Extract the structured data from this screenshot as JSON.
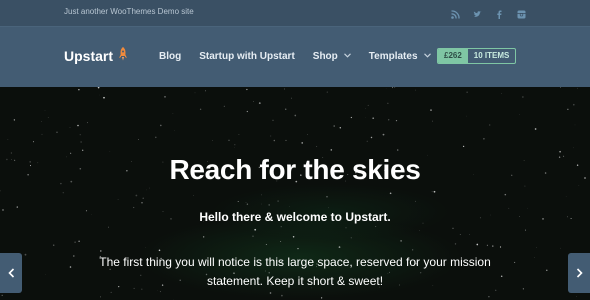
{
  "topbar": {
    "tagline": "Just another WooThemes Demo site",
    "social": [
      "rss-icon",
      "twitter-icon",
      "facebook-icon",
      "instagram-icon"
    ]
  },
  "header": {
    "logo": "Upstart",
    "logo_icon": "rocket-icon",
    "nav": [
      {
        "label": "Blog"
      },
      {
        "label": "Startup with Upstart"
      },
      {
        "label": "Shop",
        "dropdown": true
      },
      {
        "label": "Templates",
        "dropdown": true
      }
    ],
    "cart": {
      "amount": "£262",
      "items": "10 ITEMS"
    }
  },
  "hero": {
    "title": "Reach for the skies",
    "subtitle": "Hello there & welcome to Upstart.",
    "text": "The first thing you will notice is this large space, reserved for your mission statement. Keep it short & sweet!"
  },
  "slider": {
    "prev_icon": "chevron-left-icon",
    "next_icon": "chevron-right-icon"
  },
  "colors": {
    "topbar": "#3a5064",
    "header": "#435c73",
    "accent": "#7fc6a4",
    "logo_rocket": "#f08a3c"
  }
}
